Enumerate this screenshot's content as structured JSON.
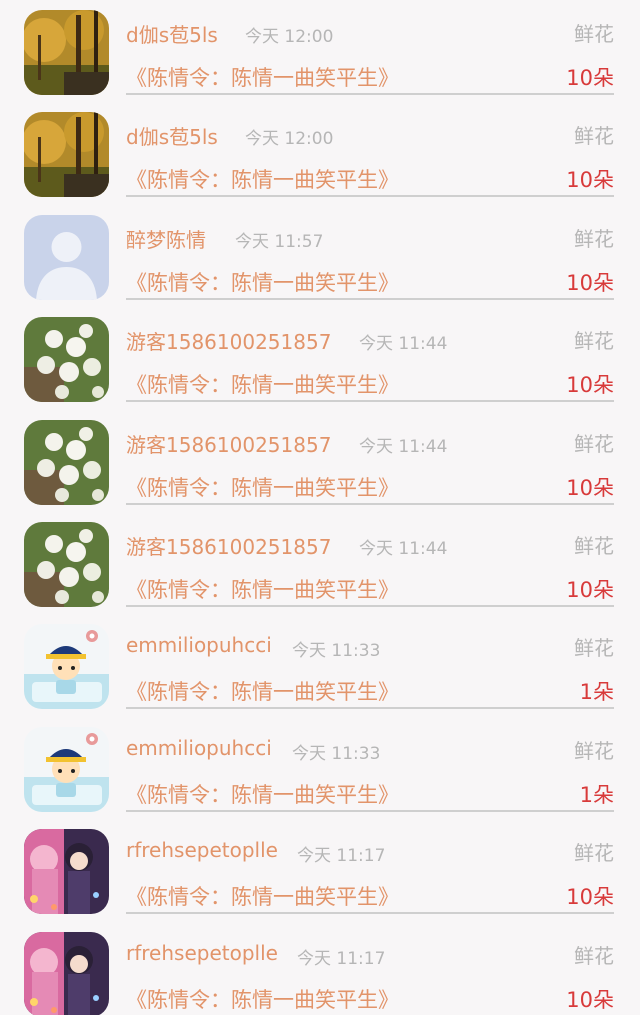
{
  "records": [
    {
      "avatar": "autumn-tree-avatar",
      "name": "d伽s苞5ls",
      "time": "今天 12:00",
      "type": "鲜花",
      "gift": "《陈情令：陈情一曲笑平生》",
      "count": "10朵"
    },
    {
      "avatar": "autumn-tree-avatar",
      "name": "d伽s苞5ls",
      "time": "今天 12:00",
      "type": "鲜花",
      "gift": "《陈情令：陈情一曲笑平生》",
      "count": "10朵"
    },
    {
      "avatar": "default-user-avatar",
      "name": "醉梦陈情",
      "time": "今天 11:57",
      "type": "鲜花",
      "gift": "《陈情令：陈情一曲笑平生》",
      "count": "10朵"
    },
    {
      "avatar": "white-flowers-avatar",
      "name": "游客1586100251857",
      "time": "今天 11:44",
      "type": "鲜花",
      "gift": "《陈情令：陈情一曲笑平生》",
      "count": "10朵"
    },
    {
      "avatar": "white-flowers-avatar",
      "name": "游客1586100251857",
      "time": "今天 11:44",
      "type": "鲜花",
      "gift": "《陈情令：陈情一曲笑平生》",
      "count": "10朵"
    },
    {
      "avatar": "white-flowers-avatar",
      "name": "游客1586100251857",
      "time": "今天 11:44",
      "type": "鲜花",
      "gift": "《陈情令：陈情一曲笑平生》",
      "count": "10朵"
    },
    {
      "avatar": "cartoon-official-avatar",
      "name": "emmiliopuhcci",
      "time": "今天 11:33",
      "type": "鲜花",
      "gift": "《陈情令：陈情一曲笑平生》",
      "count": "1朵"
    },
    {
      "avatar": "cartoon-official-avatar",
      "name": "emmiliopuhcci",
      "time": "今天 11:33",
      "type": "鲜花",
      "gift": "《陈情令：陈情一曲笑平生》",
      "count": "1朵"
    },
    {
      "avatar": "anime-couple-avatar",
      "name": "rfrehsepetoplle",
      "time": "今天 11:17",
      "type": "鲜花",
      "gift": "《陈情令：陈情一曲笑平生》",
      "count": "10朵"
    },
    {
      "avatar": "anime-couple-avatar",
      "name": "rfrehsepetoplle",
      "time": "今天 11:17",
      "type": "鲜花",
      "gift": "《陈情令：陈情一曲笑平生》",
      "count": "10朵"
    }
  ]
}
